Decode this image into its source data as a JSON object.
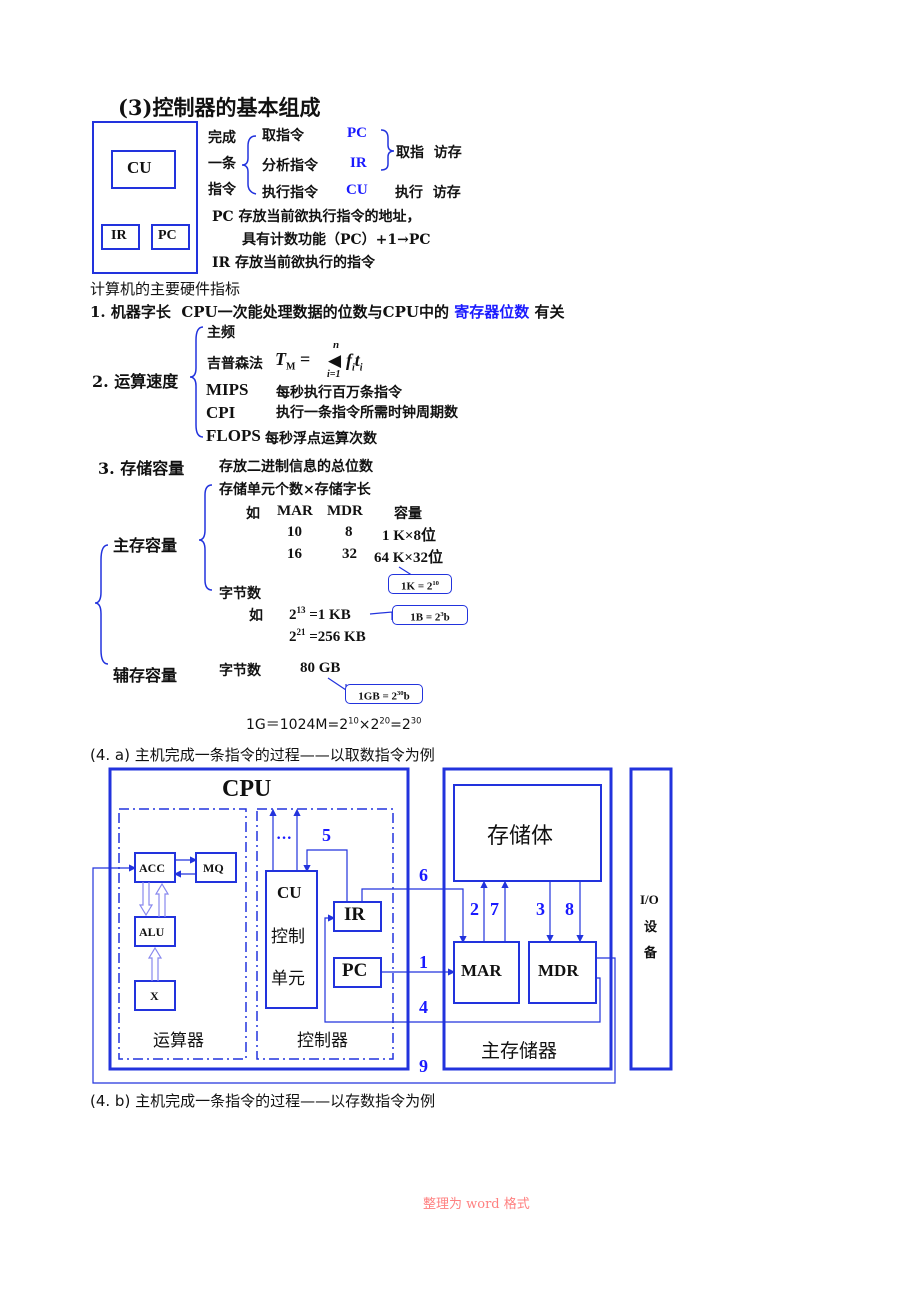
{
  "section3": {
    "title": "(3)控制器的基本组成",
    "box_cu": "CU",
    "box_ir": "IR",
    "box_pc": "PC",
    "left_label": [
      "完成",
      "一条",
      "指令"
    ],
    "steps": [
      {
        "name": "取指令",
        "reg": "PC"
      },
      {
        "name": "分析指令",
        "reg": "IR"
      },
      {
        "name": "执行指令",
        "reg": "CU"
      }
    ],
    "group1": "取指  访存",
    "group2": "执行  访存",
    "pc_desc": "PC 存放当前欲执行指令的地址，",
    "pc_desc2": "具有计数功能（PC）+1→PC",
    "ir_desc": "IR 存放当前欲执行的指令"
  },
  "indicators": {
    "heading": "计算机的主要硬件指标",
    "item1_label": "1. 机器字长",
    "item1_text": "CPU一次能处理数据的位数与CPU中的",
    "item1_highlight": "寄存器位数",
    "item1_tail": "有关",
    "item2_label": "2. 运算速度",
    "speed": {
      "freq": "主频",
      "gibson": "吉普森法",
      "formula_T": "T",
      "formula_sub": "M",
      "formula_eq": "=",
      "formula_top": "n",
      "formula_bottom": "i=1",
      "formula_body": "f",
      "formula_body_sub": "i",
      "formula_t": "t",
      "formula_t_sub": "i",
      "rows": [
        {
          "term": "MIPS",
          "desc": "每秒执行百万条指令"
        },
        {
          "term": "CPI",
          "desc": "执行一条指令所需时钟周期数"
        },
        {
          "term": "FLOPS",
          "desc": "每秒浮点运算次数"
        }
      ]
    },
    "item3_label": "3. 存储容量",
    "item3_text": "存放二进制信息的总位数",
    "main_mem": "主存容量",
    "formula1": "存储单元个数×存储字长",
    "table_head": [
      "如",
      "MAR",
      "MDR",
      "容量"
    ],
    "table_rows": [
      [
        "10",
        "8",
        "1 K×8位"
      ],
      [
        "16",
        "32",
        "64 K×32位"
      ]
    ],
    "callout_1k": "1K = 2",
    "callout_1k_exp": "10",
    "bytes_label": "字节数",
    "bytes_eg": "如",
    "bytes_rows": [
      {
        "base": "2",
        "exp": "13",
        "val": "=1 KB"
      },
      {
        "base": "2",
        "exp": "21",
        "val": "=256 KB"
      }
    ],
    "callout_1b": "1B = 2",
    "callout_1b_exp": "3",
    "callout_1b_tail": "b",
    "aux_mem": "辅存容量",
    "aux_label": "字节数",
    "aux_value": "80 GB",
    "callout_1gb": "1GB = 2",
    "callout_1gb_exp": "30",
    "callout_1gb_tail": "b",
    "eq_line": "1G＝1024M=2",
    "eq_e1": "10",
    "eq_x": "×2",
    "eq_e2": "20",
    "eq_eq": "=2",
    "eq_e3": "30"
  },
  "section4a": {
    "title": "(4. a)  主机完成一条指令的过程——以取数指令为例",
    "cpu": "CPU",
    "acc": "ACC",
    "mq": "MQ",
    "alu": "ALU",
    "x": "X",
    "alu_group": "运算器",
    "cu": "CU",
    "cu2": "控制",
    "cu3": "单元",
    "ellipsis": "···",
    "ir": "IR",
    "pc": "PC",
    "ctrl_group": "控制器",
    "storage": "存储体",
    "mar": "MAR",
    "mdr": "MDR",
    "main_memory": "主存储器",
    "io1": "I/O",
    "io2": "设",
    "io3": "备",
    "steps": [
      "1",
      "2",
      "3",
      "4",
      "5",
      "6",
      "7",
      "8",
      "9"
    ]
  },
  "section4b": {
    "title": "(4. b)  主机完成一条指令的过程——以存数指令为例"
  },
  "footer": "整理为 word 格式",
  "colors": {
    "accent": "#1a1aff",
    "line": "#2233dd",
    "footer": "#ff8080"
  }
}
